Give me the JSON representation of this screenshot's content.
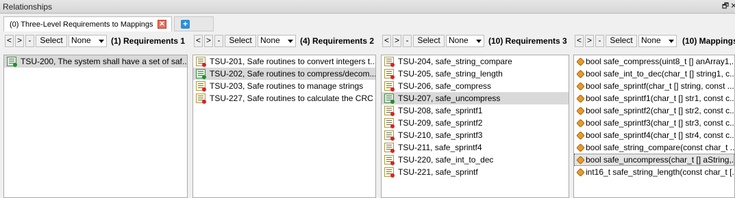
{
  "window": {
    "title": "Relationships",
    "restore_glyph": "🗗",
    "close_glyph": "✕"
  },
  "tabs": [
    {
      "label": "(0) Three-Level Requirements to Mappings",
      "close_glyph": "✕"
    }
  ],
  "add_tab_glyph": "+",
  "toolbar_common": {
    "prev": "<",
    "next": ">",
    "minus": "-",
    "select": "Select",
    "filter": "None"
  },
  "panels": [
    {
      "title": "(1) Requirements 1",
      "items": [
        {
          "text": "TSU-200, The system shall have a set of saf...",
          "icon": "requirement-green",
          "state": "selected"
        }
      ]
    },
    {
      "title": "(4) Requirements 2",
      "items": [
        {
          "text": "TSU-201, Safe routines to convert integers t...",
          "icon": "requirement",
          "state": ""
        },
        {
          "text": "TSU-202, Safe routines to compress/decom...",
          "icon": "requirement-green",
          "state": "selected"
        },
        {
          "text": "TSU-203, Safe routines to manage strings",
          "icon": "requirement",
          "state": ""
        },
        {
          "text": "TSU-227, Safe routines to calculate the CRC",
          "icon": "requirement",
          "state": ""
        }
      ]
    },
    {
      "title": "(10) Requirements 3",
      "items": [
        {
          "text": "TSU-204, safe_string_compare",
          "icon": "requirement",
          "state": ""
        },
        {
          "text": "TSU-205, safe_string_length",
          "icon": "requirement",
          "state": ""
        },
        {
          "text": "TSU-206, safe_compress",
          "icon": "requirement",
          "state": ""
        },
        {
          "text": "TSU-207, safe_uncompress",
          "icon": "requirement-green",
          "state": "selected"
        },
        {
          "text": "TSU-208, safe_sprintf1",
          "icon": "requirement",
          "state": ""
        },
        {
          "text": "TSU-209, safe_sprintf2",
          "icon": "requirement",
          "state": ""
        },
        {
          "text": "TSU-210, safe_sprintf3",
          "icon": "requirement",
          "state": ""
        },
        {
          "text": "TSU-211, safe_sprintf4",
          "icon": "requirement",
          "state": ""
        },
        {
          "text": "TSU-220, safe_int_to_dec",
          "icon": "requirement",
          "state": ""
        },
        {
          "text": "TSU-221, safe_sprintf",
          "icon": "requirement",
          "state": ""
        }
      ]
    },
    {
      "title": "(10) Mappings",
      "items": [
        {
          "text": "bool safe_compress(uint8_t [] anArray1,...",
          "icon": "mapping",
          "state": ""
        },
        {
          "text": "bool safe_int_to_dec(char_t [] string1, c...",
          "icon": "mapping",
          "state": ""
        },
        {
          "text": "bool safe_sprintf(char_t [] string, const ...",
          "icon": "mapping",
          "state": ""
        },
        {
          "text": "bool safe_sprintf1(char_t [] str1, const c...",
          "icon": "mapping",
          "state": ""
        },
        {
          "text": "bool safe_sprintf2(char_t [] str2, const c...",
          "icon": "mapping",
          "state": ""
        },
        {
          "text": "bool safe_sprintf3(char_t [] str3, const c...",
          "icon": "mapping",
          "state": ""
        },
        {
          "text": "bool safe_sprintf4(char_t [] str4, const c...",
          "icon": "mapping",
          "state": ""
        },
        {
          "text": "bool safe_string_compare(const char_t ...",
          "icon": "mapping",
          "state": ""
        },
        {
          "text": "bool safe_uncompress(char_t [] aString,...",
          "icon": "mapping",
          "state": "focused"
        },
        {
          "text": "int16_t safe_string_length(const char_t [...",
          "icon": "mapping",
          "state": ""
        }
      ]
    }
  ]
}
